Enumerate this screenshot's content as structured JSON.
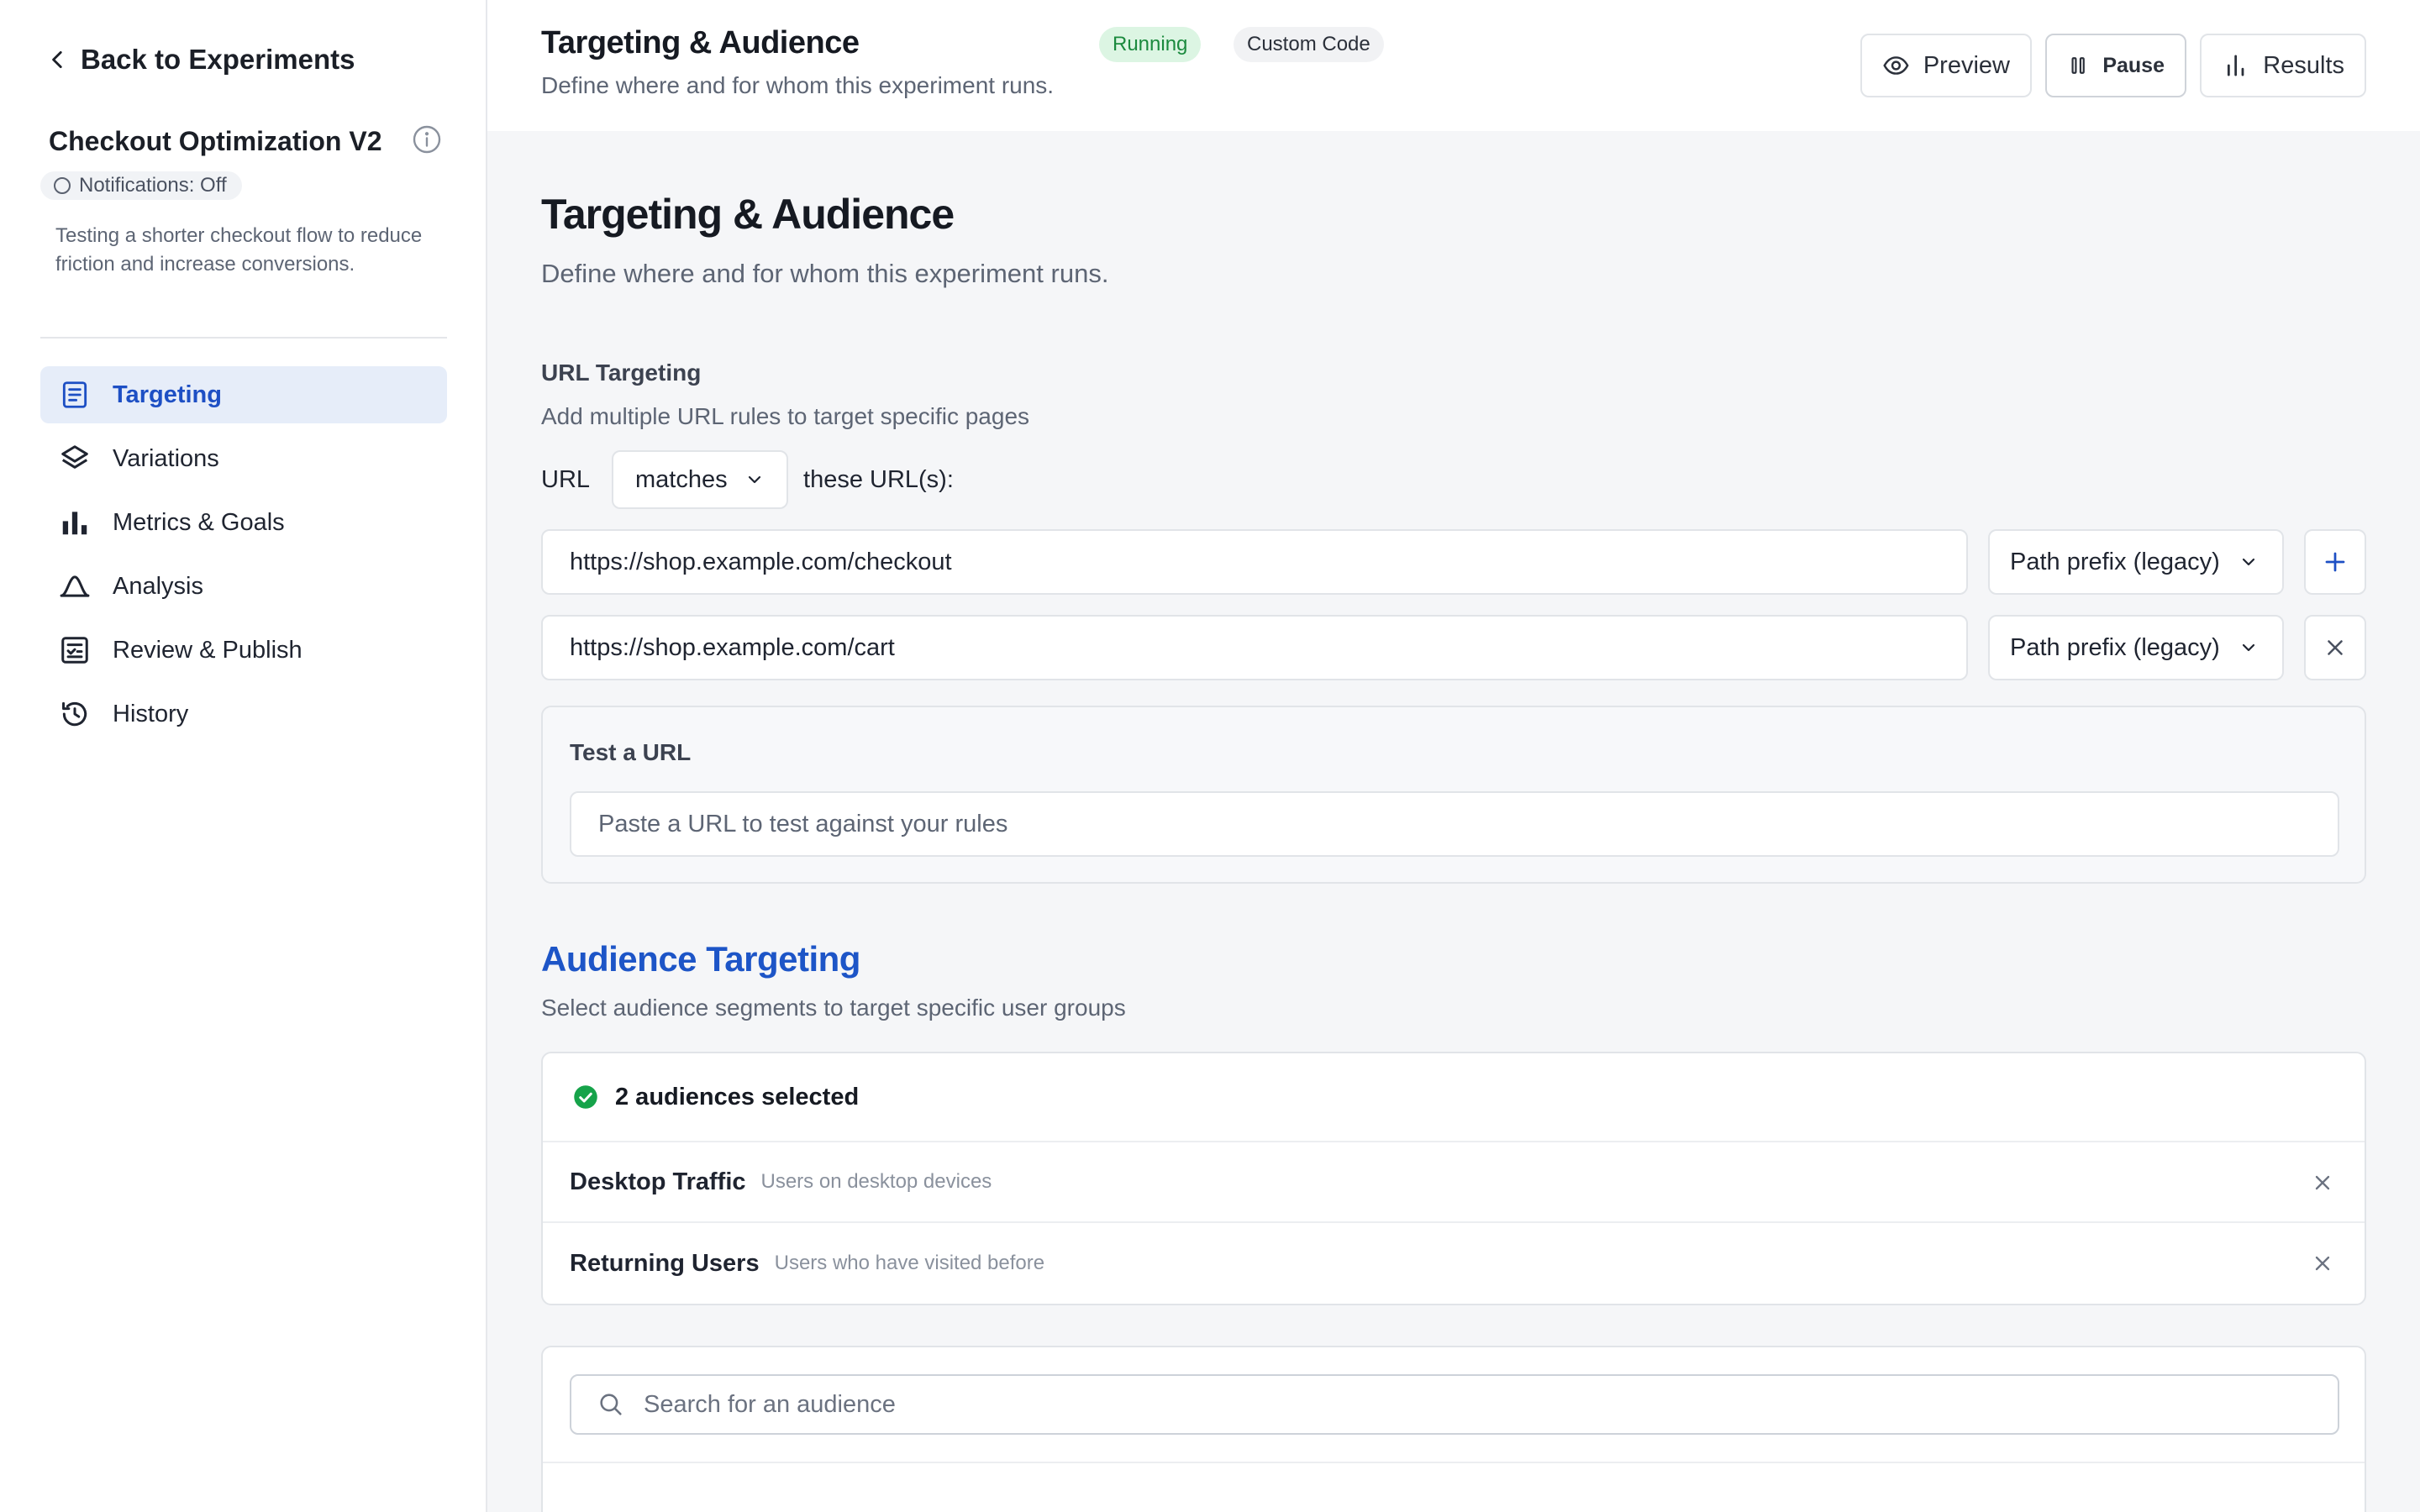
{
  "sidebar": {
    "back_label": "Back to Experiments",
    "experiment_title": "Checkout Optimization V2",
    "notifications": "Notifications: Off",
    "description": "Testing a shorter checkout flow to reduce friction and increase conversions.",
    "items": [
      {
        "label": "Targeting",
        "icon": "document-icon",
        "active": true
      },
      {
        "label": "Variations",
        "icon": "layers-icon"
      },
      {
        "label": "Metrics & Goals",
        "icon": "bar-chart-icon"
      },
      {
        "label": "Analysis",
        "icon": "bell-curve-icon"
      },
      {
        "label": "Review & Publish",
        "icon": "checklist-icon"
      },
      {
        "label": "History",
        "icon": "history-icon"
      }
    ]
  },
  "header": {
    "title": "Targeting & Audience",
    "subtitle": "Define where and for whom this experiment runs.",
    "status_badge": "Running",
    "type_badge": "Custom Code",
    "preview_label": "Preview",
    "pause_label": "Pause",
    "results_label": "Results"
  },
  "page": {
    "title": "Targeting & Audience",
    "subtitle": "Define where and for whom this experiment runs."
  },
  "url_targeting": {
    "label": "URL Targeting",
    "sub": "Add multiple URL rules to target specific pages",
    "prefix": "URL",
    "match_mode": "matches",
    "suffix": "these URL(s):",
    "rules": [
      {
        "url": "https://shop.example.com/checkout",
        "type": "Path prefix (legacy)",
        "action": "add"
      },
      {
        "url": "https://shop.example.com/cart",
        "type": "Path prefix (legacy)",
        "action": "remove"
      }
    ],
    "test_label": "Test a URL",
    "test_placeholder": "Paste a URL to test against your rules"
  },
  "audience": {
    "title": "Audience Targeting",
    "sub": "Select audience segments to target specific user groups",
    "selected_summary": "2 audiences selected",
    "items": [
      {
        "name": "Desktop Traffic",
        "desc": "Users on desktop devices"
      },
      {
        "name": "Returning Users",
        "desc": "Users who have visited before"
      }
    ],
    "search_placeholder": "Search for an audience"
  },
  "colors": {
    "accent": "#1d4fc4",
    "running_bg": "#dcf5e3",
    "running_text": "#1b8a3e",
    "success": "#16a34a"
  }
}
